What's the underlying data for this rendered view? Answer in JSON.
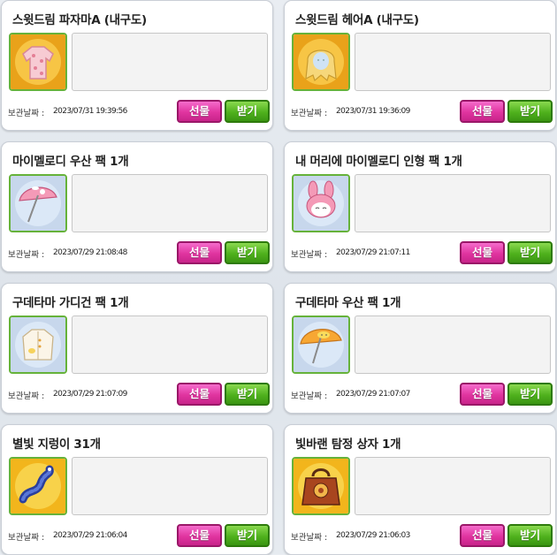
{
  "storage_label": "보관날짜 :",
  "buttons": {
    "gift": "선물",
    "receive": "받기"
  },
  "items": [
    {
      "title": "스윗드림 파자마A (내구도)",
      "date": "2023/07/31 19:39:56",
      "icon": "pajama-icon"
    },
    {
      "title": "스윗드림 헤어A (내구도)",
      "date": "2023/07/31 19:36:09",
      "icon": "blonde-hair-icon"
    },
    {
      "title": "마이멜로디 우산 팩 1개",
      "date": "2023/07/29 21:08:48",
      "icon": "my-melody-umbrella-icon"
    },
    {
      "title": "내 머리에 마이멜로디 인형 팩 1개",
      "date": "2023/07/29 21:07:11",
      "icon": "my-melody-doll-icon"
    },
    {
      "title": "구데타마 가디건 팩 1개",
      "date": "2023/07/29 21:07:09",
      "icon": "cardigan-icon"
    },
    {
      "title": "구데타마 우산 팩 1개",
      "date": "2023/07/29 21:07:07",
      "icon": "gudetama-umbrella-icon"
    },
    {
      "title": "별빛 지렁이 31개",
      "date": "2023/07/29 21:06:04",
      "icon": "starlight-worm-icon"
    },
    {
      "title": "빛바랜 탐정 상자 1개",
      "date": "2023/07/29 21:06:03",
      "icon": "detective-box-icon"
    }
  ],
  "colors": {
    "gift_button": "#e0349f",
    "receive_button": "#4fb11d",
    "icon_border": "#66b23a"
  }
}
